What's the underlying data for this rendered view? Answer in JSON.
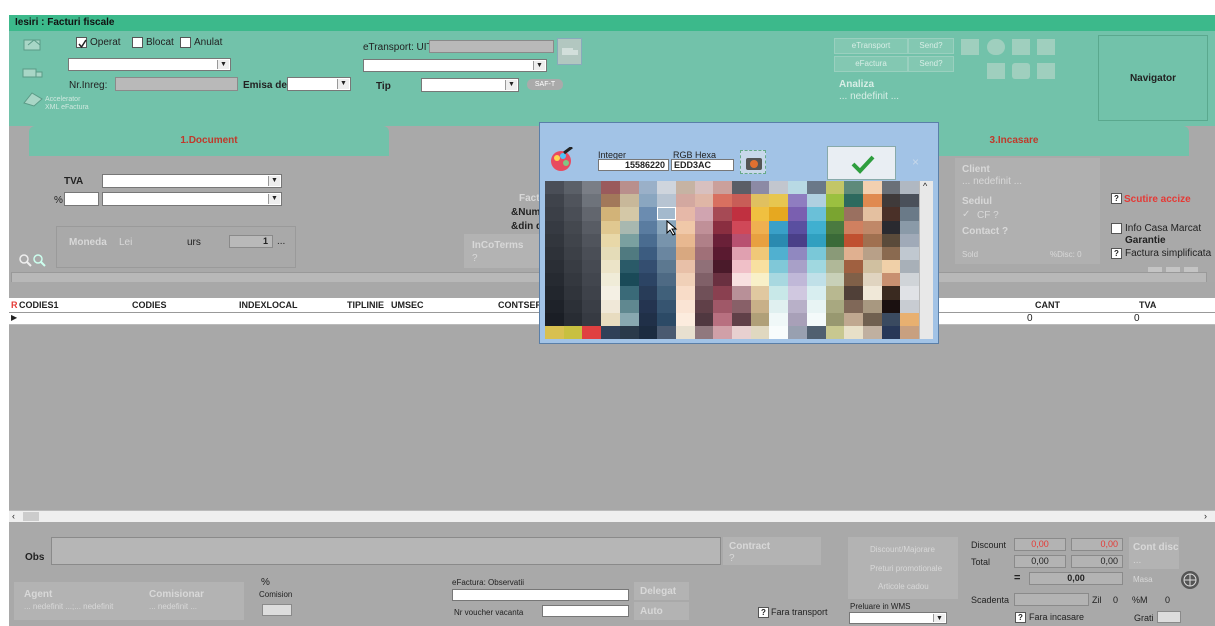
{
  "window": {
    "title": "Iesiri : Facturi fiscale"
  },
  "header": {
    "operat": "Operat",
    "blocat": "Blocat",
    "anulat": "Anulat",
    "nr_inreg": "Nr.Inreg:",
    "emisa_de": "Emisa de",
    "tip": "Tip",
    "etransport_uit": "eTransport: UIT",
    "saft": "SAF-T",
    "accelerator_1": "Accelerator",
    "accelerator_2": "XML eFactura",
    "etransport_btn": "eTransport",
    "send1": "Send?",
    "efactura_btn": "eFactura",
    "send2": "Send?",
    "analiza": "Analiza",
    "analiza_val": "... nedefinit ...",
    "navigator": "Navigator"
  },
  "tabs": [
    {
      "label": "1.Document"
    },
    {
      "label": "3.Incasare"
    }
  ],
  "document": {
    "tva": "TVA",
    "pct": "%",
    "moneda": "Moneda",
    "moneda_val": "Lei",
    "curs": "urs",
    "curs_val": "1",
    "curs_more": "...",
    "factura": "Factu",
    "numar": "&Num",
    "din_data": "&din d",
    "incoterms": "InCoTerms",
    "incoterms_val": "?"
  },
  "incasare": {
    "client": "Client",
    "client_val": "... nedefinit ...",
    "sediul": "Sediul",
    "cf": "CF ?",
    "contact": "Contact ?",
    "sold": "Sold",
    "disc": "%Disc: 0",
    "scutire": "Scutire accize",
    "scutire_q": "?",
    "info_casa": "Info Casa Marcat",
    "garantie": "Garantie",
    "factura_simpl": "Factura simplificata",
    "factura_q": "?"
  },
  "grid": {
    "r_marker": "R",
    "columns": [
      "CODIES1",
      "CODIES",
      "INDEXLOCAL",
      "TIPLINIE",
      "UMSEC",
      "CONTSER",
      "CANT",
      "TVA"
    ],
    "row": {
      "cant": "0",
      "tva": "0"
    }
  },
  "color_picker": {
    "integer_label": "Integer",
    "integer_value": "15586220",
    "hex_label": "RGB Hexa",
    "hex_value": "EDD3AC",
    "close": "×",
    "colors": [
      "#4a4e57",
      "#5b6068",
      "#7a7e86",
      "#9a5a5c",
      "#b98f8c",
      "#9ab0c8",
      "#cfd5dd",
      "#c6b3a3",
      "#d8c0bf",
      "#cba09b",
      "#5a5e66",
      "#8c8aa5",
      "#c2c6ce",
      "#b8d9e4",
      "#6a7888",
      "#c3c667",
      "#5e8a7a",
      "#f3d0b0",
      "#6a7078",
      "#b0b8c2",
      "#3f434b",
      "#50545c",
      "#6e737b",
      "#a2785a",
      "#c8b89a",
      "#8aa6c0",
      "#b7c4d2",
      "#d3a8a0",
      "#dfb6a6",
      "#d87060",
      "#c85d57",
      "#e0c060",
      "#e7c650",
      "#8f7dc0",
      "#b0d0e0",
      "#9bc040",
      "#2d6a5e",
      "#e08a50",
      "#3f3a3a",
      "#4a505a",
      "#3b3f47",
      "#4a4e56",
      "#62666e",
      "#d2b378",
      "#d4c8a7",
      "#6b8cb0",
      "#a3b9cd",
      "#e6b8a8",
      "#d0a4b0",
      "#a64a55",
      "#c03040",
      "#f0c040",
      "#e6a820",
      "#7a5fb0",
      "#6ac0d8",
      "#7aa430",
      "#9a7060",
      "#e4c0a0",
      "#4a3028",
      "#6a7a88",
      "#363a42",
      "#44484f",
      "#585c64",
      "#e0c890",
      "#a8b8b0",
      "#5a7ca0",
      "#8aa6bc",
      "#f0c8a8",
      "#c09098",
      "#8a2e40",
      "#d04858",
      "#f0b050",
      "#3aa0c8",
      "#5a4fa0",
      "#40b0d0",
      "#4a7a40",
      "#d08060",
      "#c08868",
      "#2a2a30",
      "#8a9aa8",
      "#32363d",
      "#40444b",
      "#50545c",
      "#e8d8a8",
      "#7aa0a0",
      "#4a6c90",
      "#7894ac",
      "#e8b890",
      "#b08088",
      "#6a2038",
      "#b85070",
      "#e8a040",
      "#2a8ab0",
      "#4a3f88",
      "#30a0c0",
      "#3a6a38",
      "#c05030",
      "#a07050",
      "#5a4a3a",
      "#a0aab8",
      "#2e3239",
      "#3c4047",
      "#4a4e56",
      "#e4dcb8",
      "#507a80",
      "#3c5c80",
      "#6a86a0",
      "#d8a880",
      "#a07078",
      "#5a1a30",
      "#e0a0b0",
      "#f0c878",
      "#50b0d0",
      "#9088c0",
      "#7ac8d8",
      "#8a9a78",
      "#e0b090",
      "#b8a088",
      "#8a6a50",
      "#c0c8d0",
      "#2a2e35",
      "#383c43",
      "#464a52",
      "#ece4c8",
      "#2a5a68",
      "#344e70",
      "#5c7890",
      "#e8c0a8",
      "#907078",
      "#4a1a2a",
      "#f0c0c8",
      "#f8e0a0",
      "#80c8d8",
      "#a8a0c8",
      "#a0d8e0",
      "#b0b898",
      "#a06040",
      "#d0c0a0",
      "#f0d0a8",
      "#a8b0b8",
      "#262a31",
      "#34383f",
      "#42464e",
      "#f0ecd8",
      "#1a4a58",
      "#2c4464",
      "#4e6a84",
      "#f0d0b8",
      "#806068",
      "#6a3040",
      "#f8e0e0",
      "#f8f0c8",
      "#a8d8e0",
      "#c0b8d8",
      "#c0e0e8",
      "#c8d0b8",
      "#806048",
      "#e0d4c0",
      "#c89070",
      "#d0d4d8",
      "#22262d",
      "#30343b",
      "#3e424a",
      "#f4f0e4",
      "#3a6a78",
      "#283c58",
      "#40607a",
      "#f8dcc8",
      "#705058",
      "#8a4050",
      "#b89098",
      "#e0c8a0",
      "#c8e8e8",
      "#d0c8e0",
      "#d8eef0",
      "#b8b890",
      "#504038",
      "#f0e8d8",
      "#3a2a20",
      "#e0e2e6",
      "#1e2229",
      "#2c3037",
      "#3a3e46",
      "#f0e8d8",
      "#608890",
      "#243450",
      "#365470",
      "#fae4d4",
      "#604048",
      "#a05868",
      "#886068",
      "#c8b088",
      "#e0f0f0",
      "#b8b0c8",
      "#e8f4f4",
      "#a8a880",
      "#806858",
      "#a89880",
      "#1a1010",
      "#c8ccd2",
      "#1a1e25",
      "#282c33",
      "#363a42",
      "#e8dcc0",
      "#88a8b0",
      "#203048",
      "#2c4a66",
      "#fcecde",
      "#503840",
      "#b87080",
      "#604048",
      "#b0a078",
      "#f0f8f8",
      "#a8a0b8",
      "#f4fafa",
      "#989870",
      "#c0a890",
      "#706050",
      "#3a4a60",
      "#e8b070",
      "#d8c050",
      "#c8c040",
      "#e04040",
      "#304058",
      "#2a3a4a",
      "#1c2c40",
      "#4a5a70",
      "#e8e0d0",
      "#90787e",
      "#d0a0a8",
      "#e8d0d0",
      "#e0d8c0",
      "#f8fcfc",
      "#98a0b0",
      "#506070",
      "#c8c890",
      "#e8e0c8",
      "#c0b0a0",
      "#283858",
      "#c8a080"
    ]
  },
  "bottom": {
    "obs": "Obs",
    "contract": "Contract",
    "contract_val": "?",
    "agent": "Agent",
    "agent_val": "... nedefinit ...;... nedefinit",
    "comisionar": "Comisionar",
    "comisionar_val": "... nedefinit ...",
    "pct": "%",
    "comision": "Comision",
    "efactura_obs": "eFactura: Observatii",
    "nr_voucher": "Nr voucher vacanta",
    "delegat": "Delegat",
    "auto": "Auto",
    "fara_transport": "Fara transport",
    "fara_transport_q": "?",
    "discount_maj": "Discount/Majorare",
    "preturi_promo": "Preturi promotionale",
    "articole_cadou": "Articole cadou",
    "preluare_wms": "Preluare in WMS",
    "discount": "Discount",
    "discount_v1": "0,00",
    "discount_v2": "0,00",
    "total": "Total",
    "total_v1": "0,00",
    "total_v2": "0,00",
    "grand_total": "0,00",
    "eq": "=",
    "cont_disc": "Cont disc",
    "cont_disc_val": "...",
    "masa": "Masa",
    "scadenta": "Scadenta",
    "zil": "Zil",
    "zil_val": "0",
    "pm": "%M",
    "pm_val": "0",
    "fara_incasare": "Fara incasare",
    "fara_incasare_q": "?",
    "grati": "Grati"
  }
}
